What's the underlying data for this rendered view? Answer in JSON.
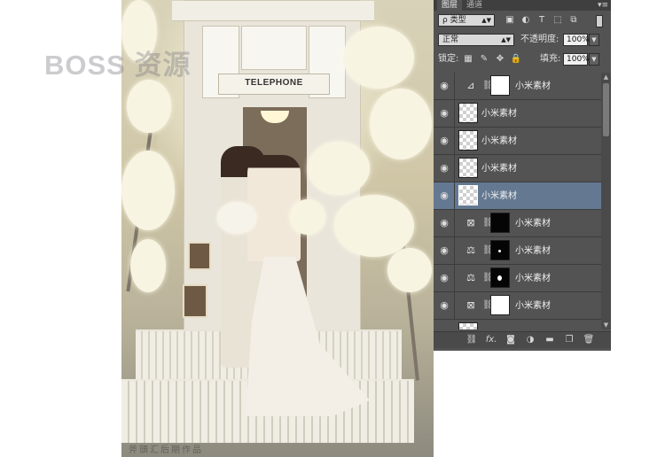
{
  "watermark": "BOSS 资源",
  "caption": "斧頭汇后期作品",
  "photo": {
    "booth_sign": "TELEPHONE"
  },
  "panel": {
    "tabs": [
      {
        "label": "图层",
        "active": true
      },
      {
        "label": "通道",
        "active": false
      }
    ],
    "menu_icon": "panel-menu-icon",
    "filter": {
      "label": "ρ 类型"
    },
    "blend_mode": "正常",
    "opacity_label": "不透明度:",
    "opacity_value": "100%",
    "lock_label": "锁定:",
    "fill_label": "填充:",
    "fill_value": "100%",
    "layers": [
      {
        "name": "小米素材",
        "type": "adjustment",
        "adj_icon": "curves-icon",
        "mask": "white",
        "selected": false
      },
      {
        "name": "小米素材",
        "type": "pixel",
        "selected": false
      },
      {
        "name": "小米素材",
        "type": "pixel",
        "selected": false
      },
      {
        "name": "小米素材",
        "type": "pixel",
        "selected": false
      },
      {
        "name": "小米素材",
        "type": "pixel",
        "selected": true
      },
      {
        "name": "小米素材",
        "type": "adjustment",
        "adj_icon": "channel-mixer-icon",
        "mask": "black",
        "selected": false
      },
      {
        "name": "小米素材",
        "type": "adjustment",
        "adj_icon": "color-balance-icon",
        "mask": "black",
        "selected": false
      },
      {
        "name": "小米素材",
        "type": "adjustment",
        "adj_icon": "color-balance-icon",
        "mask": "black",
        "selected": false
      },
      {
        "name": "小米素材",
        "type": "adjustment",
        "adj_icon": "channel-mixer-icon",
        "mask": "white",
        "selected": false
      }
    ],
    "footer_icons": [
      "link-layers-icon",
      "fx-icon",
      "add-mask-icon",
      "adjustment-layer-icon",
      "new-group-icon",
      "new-layer-icon",
      "trash-icon"
    ],
    "footer_fx_text": "fx."
  }
}
